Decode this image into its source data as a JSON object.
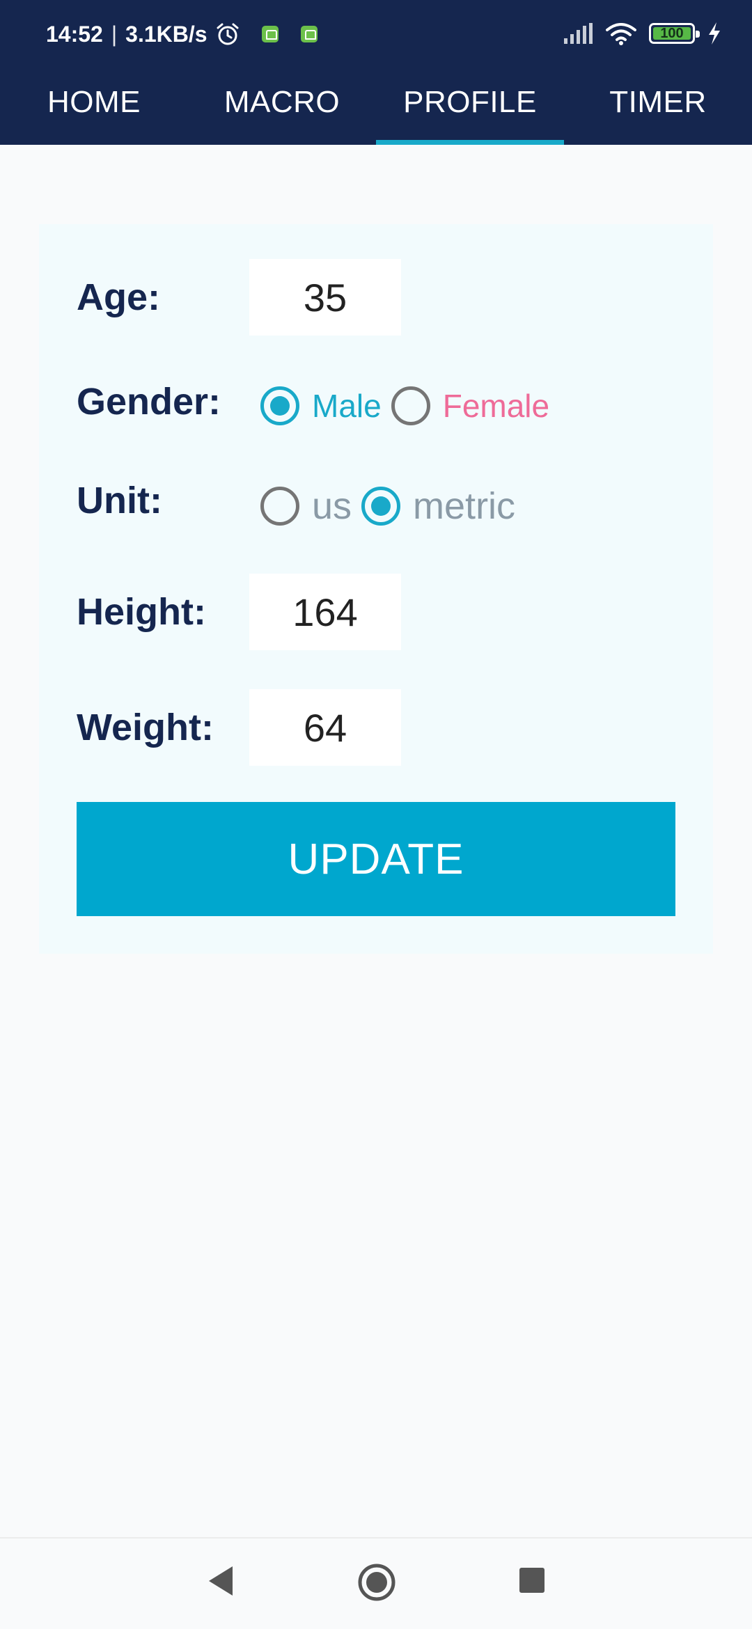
{
  "status_bar": {
    "time": "14:52",
    "separator": "|",
    "network_speed": "3.1KB/s",
    "battery_level": "100",
    "icons": [
      "alarm-icon",
      "app-notification-icon",
      "app-notification-icon",
      "signal-icon",
      "wifi-icon",
      "battery-icon",
      "charging-icon"
    ]
  },
  "tabs": [
    {
      "label": "HOME",
      "active": false
    },
    {
      "label": "MACRO",
      "active": false
    },
    {
      "label": "PROFILE",
      "active": true
    },
    {
      "label": "TIMER",
      "active": false
    }
  ],
  "profile": {
    "age": {
      "label": "Age:",
      "value": "35"
    },
    "gender": {
      "label": "Gender:",
      "options": [
        {
          "label": "Male",
          "checked": true,
          "color": "#19a9c9"
        },
        {
          "label": "Female",
          "checked": false,
          "color": "#ee6b98"
        }
      ]
    },
    "unit": {
      "label": "Unit:",
      "options": [
        {
          "label": "us",
          "checked": false,
          "color": "#8a9aa6"
        },
        {
          "label": "metric",
          "checked": true,
          "color": "#8a9aa6"
        }
      ]
    },
    "height": {
      "label": "Height:",
      "value": "164"
    },
    "weight": {
      "label": "Weight:",
      "value": "64"
    },
    "update_label": "UPDATE"
  },
  "colors": {
    "header_bg": "#15264f",
    "accent": "#00a7ce",
    "label_text": "#15264f",
    "female": "#ee6b98"
  },
  "nav_bar": {
    "icons": [
      "back-icon",
      "home-icon",
      "recents-icon"
    ]
  }
}
